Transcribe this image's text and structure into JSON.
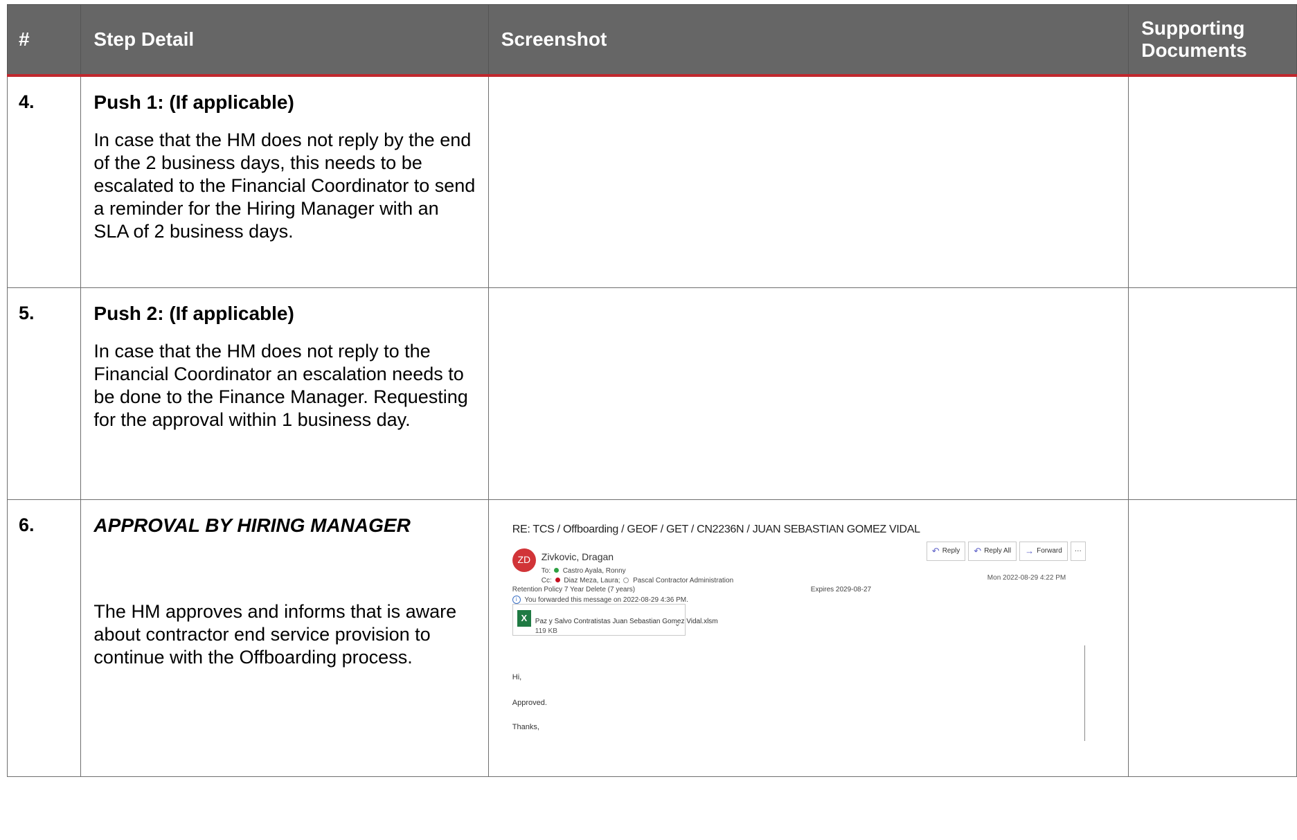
{
  "headers": {
    "num": "#",
    "step_detail": "Step Detail",
    "screenshot": "Screenshot",
    "supporting_line1": "Supporting",
    "supporting_line2": "Documents"
  },
  "rows": [
    {
      "num": "4.",
      "title": "Push 1: (If applicable)",
      "description": "In case that the HM does not reply by the end of the 2 business days, this needs to be escalated to the Financial Coordinator to send a reminder for the Hiring Manager with an SLA of 2 business days."
    },
    {
      "num": "5.",
      "title": "Push 2: (If applicable)",
      "description": "In case that the HM does not reply to the Financial Coordinator an escalation needs to be done to the Finance Manager. Requesting for the approval within 1 business day."
    },
    {
      "num": "6.",
      "title": "APPROVAL BY HIRING MANAGER",
      "description": "The HM approves and informs that is aware about contractor end service provision to continue with the Offboarding process."
    }
  ],
  "email": {
    "subject": "RE: TCS / Offboarding / GEOF / GET  / CN2236N / JUAN SEBASTIAN GOMEZ VIDAL",
    "avatar_initials": "ZD",
    "from": "Zivkovic, Dragan",
    "to_label": "To:",
    "to": "Castro Ayala, Ronny",
    "cc_label": "Cc:",
    "cc1": "Diaz Meza, Laura;",
    "cc2": "Pascal Contractor Administration",
    "retention": "Retention Policy  7 Year Delete (7 years)",
    "expires": "Expires  2029-08-27",
    "forwarded_note": "You forwarded this message on 2022-08-29 4:36 PM.",
    "reply_label": "Reply",
    "reply_all_label": "Reply All",
    "forward_label": "Forward",
    "more_label": "···",
    "date": "Mon 2022-08-29 4:22 PM",
    "attachment_name": "Paz y Salvo Contratistas Juan Sebastian Gomez Vidal.xlsm",
    "attachment_size": "119 KB",
    "body_greeting": "Hi,",
    "body_text": "Approved.",
    "body_closing": "Thanks,"
  }
}
